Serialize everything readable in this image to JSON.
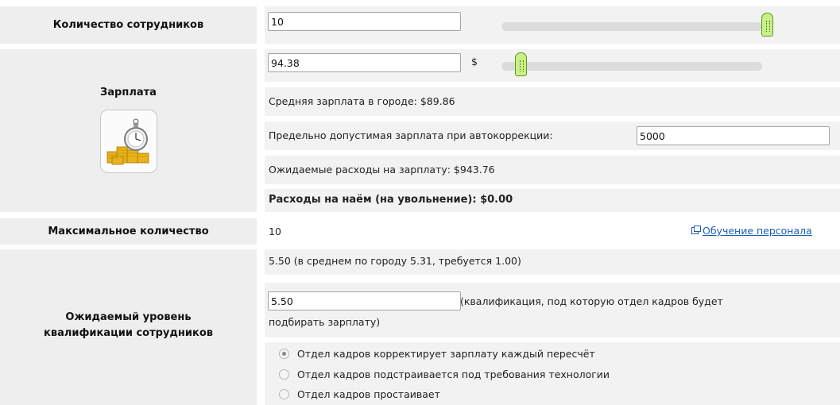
{
  "employees": {
    "label": "Количество сотрудников",
    "value": "10",
    "slider_level": 1.0
  },
  "salary": {
    "label": "Зарплата",
    "value": "94.38",
    "currency": "$",
    "slider_level": 0.05,
    "icon": "money-stopwatch-icon",
    "city_avg": "Средняя зарплата в городе: $89.86",
    "autocorrect_label": "Предельно допустимая зарплата при автокоррекции:",
    "autocorrect_value": "5000",
    "expected_expenses": "Ожидаемые расходы на зарплату: $943.76",
    "hire_expenses": "Расходы на наём (на увольнение): $0.00"
  },
  "max_count": {
    "label": "Максимальное количество",
    "value": "10",
    "training_link": "Обучение персонала"
  },
  "qualification": {
    "label": "Ожидаемый уровень квалификации сотрудников",
    "summary": "5.50 (в среднем по городу 5.31, требуется 1.00)",
    "value": "5.50",
    "hint_part1": "(квалификация, под которую отдел кадров будет",
    "hint_part2": "подбирать зарплату)",
    "options": [
      {
        "label": "Отдел кадров корректирует зарплату каждый пересчёт",
        "checked": true
      },
      {
        "label": "Отдел кадров подстраивается под требования технологии",
        "checked": false
      },
      {
        "label": "Отдел кадров простаивает",
        "checked": false
      }
    ]
  },
  "colors": {
    "label_bg": "#eeeeee",
    "cell_bg": "#f2f2f2",
    "slider_thumb": "#c9f08a",
    "link": "#1a5fb4"
  }
}
